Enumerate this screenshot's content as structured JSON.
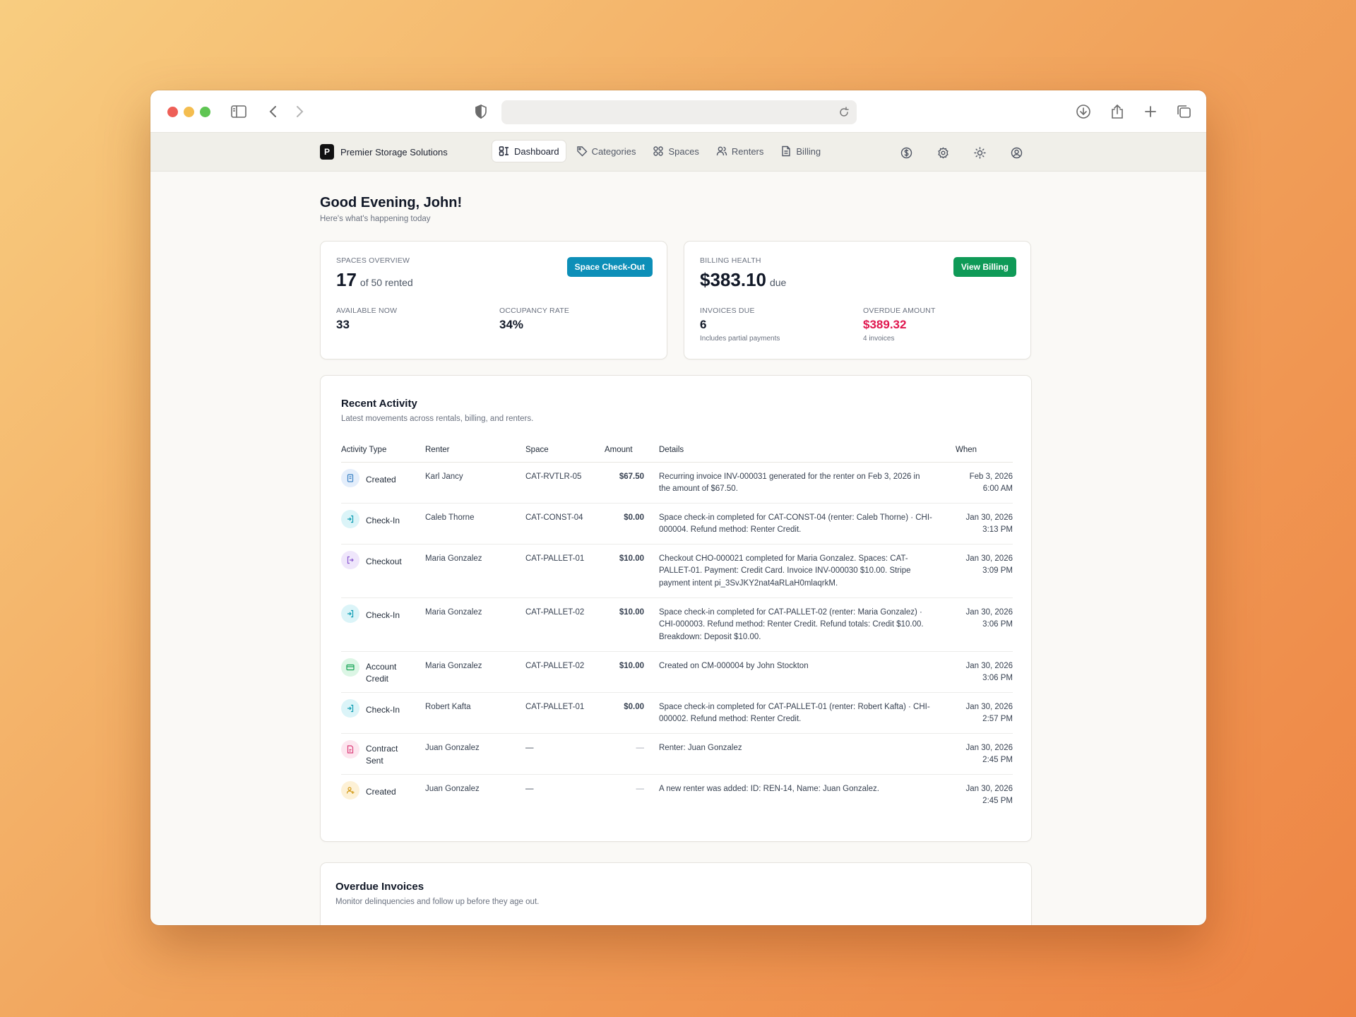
{
  "app": {
    "brand_initial": "P",
    "brand_name": "Premier Storage Solutions",
    "nav": [
      {
        "label": "Dashboard",
        "icon": "dashboard-icon",
        "active": true
      },
      {
        "label": "Categories",
        "icon": "tag-icon",
        "active": false
      },
      {
        "label": "Spaces",
        "icon": "grid-icon",
        "active": false
      },
      {
        "label": "Renters",
        "icon": "users-icon",
        "active": false
      },
      {
        "label": "Billing",
        "icon": "file-icon",
        "active": false
      }
    ]
  },
  "header": {
    "title": "Good Evening, John!",
    "subtitle": "Here's what's happening today"
  },
  "spaces_overview": {
    "label": "SPACES OVERVIEW",
    "rented": "17",
    "rented_suffix": "of 50 rented",
    "button": "Space Check-Out",
    "available_label": "AVAILABLE NOW",
    "available_value": "33",
    "occupancy_label": "OCCUPANCY RATE",
    "occupancy_value": "34%"
  },
  "billing_health": {
    "label": "BILLING HEALTH",
    "amount": "$383.10",
    "amount_suffix": "due",
    "button": "View Billing",
    "invoices_label": "INVOICES DUE",
    "invoices_value": "6",
    "invoices_note": "Includes partial payments",
    "overdue_label": "OVERDUE AMOUNT",
    "overdue_value": "$389.32",
    "overdue_note": "4 invoices",
    "overdue_color": "#e0164e"
  },
  "recent_activity": {
    "title": "Recent Activity",
    "subtitle": "Latest movements across rentals, billing, and renters.",
    "columns": [
      "Activity Type",
      "Renter",
      "Space",
      "Amount",
      "Details",
      "When"
    ],
    "rows": [
      {
        "type": "Created",
        "icon": "invoice-icon",
        "renter": "Karl Jancy",
        "space": "CAT-RVTLR-05",
        "amount": "$67.50",
        "details": "Recurring invoice INV-000031 generated for the renter on Feb 3, 2026 in the amount of $67.50.",
        "date": "Feb 3, 2026",
        "time": "6:00 AM"
      },
      {
        "type": "Check-In",
        "icon": "check-in-icon",
        "renter": "Caleb Thorne",
        "space": "CAT-CONST-04",
        "amount": "$0.00",
        "details": "Space check-in completed for CAT-CONST-04 (renter: Caleb Thorne) · CHI-000004. Refund method: Renter Credit.",
        "date": "Jan 30, 2026",
        "time": "3:13 PM"
      },
      {
        "type": "Checkout",
        "icon": "checkout-icon",
        "renter": "Maria Gonzalez",
        "space": "CAT-PALLET-01",
        "amount": "$10.00",
        "details": "Checkout CHO-000021 completed for Maria Gonzalez. Spaces: CAT-PALLET-01. Payment: Credit Card. Invoice INV-000030 $10.00. Stripe payment intent pi_3SvJKY2nat4aRLaH0mlaqrkM.",
        "date": "Jan 30, 2026",
        "time": "3:09 PM"
      },
      {
        "type": "Check-In",
        "icon": "check-in-icon",
        "renter": "Maria Gonzalez",
        "space": "CAT-PALLET-02",
        "amount": "$10.00",
        "details": "Space check-in completed for CAT-PALLET-02 (renter: Maria Gonzalez) · CHI-000003. Refund method: Renter Credit. Refund totals: Credit $10.00. Breakdown: Deposit $10.00.",
        "date": "Jan 30, 2026",
        "time": "3:06 PM"
      },
      {
        "type": "Account Credit",
        "icon": "credit-card-icon",
        "renter": "Maria Gonzalez",
        "space": "CAT-PALLET-02",
        "amount": "$10.00",
        "details": "Created on CM-000004 by John Stockton",
        "date": "Jan 30, 2026",
        "time": "3:06 PM"
      },
      {
        "type": "Check-In",
        "icon": "check-in-icon",
        "renter": "Robert Kafta",
        "space": "CAT-PALLET-01",
        "amount": "$0.00",
        "details": "Space check-in completed for CAT-PALLET-01 (renter: Robert Kafta) · CHI-000002. Refund method: Renter Credit.",
        "date": "Jan 30, 2026",
        "time": "2:57 PM"
      },
      {
        "type": "Contract Sent",
        "icon": "contract-icon",
        "renter": "Juan Gonzalez",
        "space": "—",
        "amount": "—",
        "details": "Renter: Juan Gonzalez",
        "date": "Jan 30, 2026",
        "time": "2:45 PM"
      },
      {
        "type": "Created",
        "icon": "user-plus-icon",
        "renter": "Juan Gonzalez",
        "space": "—",
        "amount": "—",
        "details": "A new renter was added: ID: REN-14, Name: Juan Gonzalez.",
        "date": "Jan 30, 2026",
        "time": "2:45 PM"
      }
    ]
  },
  "overdue_invoices": {
    "title": "Overdue Invoices",
    "subtitle": "Monitor delinquencies and follow up before they age out."
  }
}
